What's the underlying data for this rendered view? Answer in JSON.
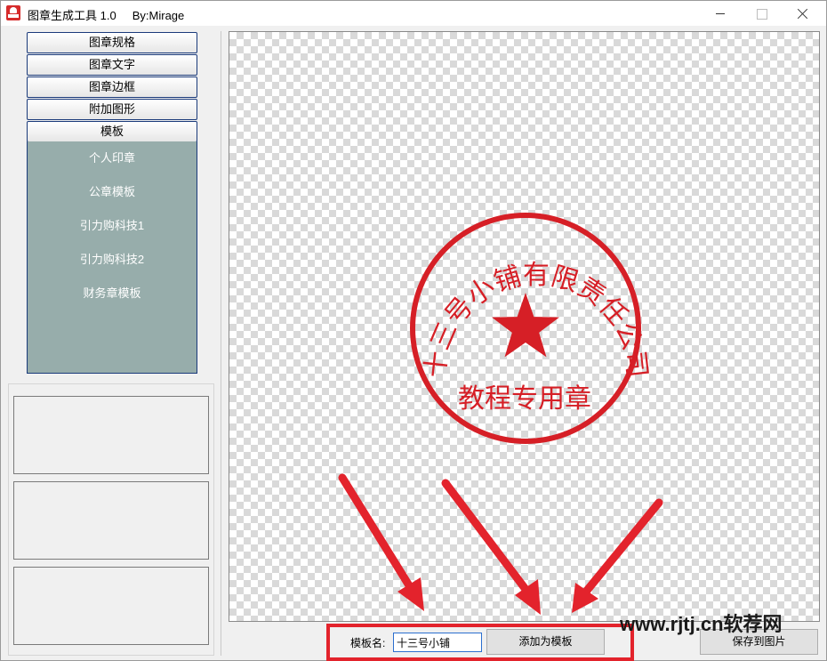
{
  "window": {
    "title": "图章生成工具 1.0     By:Mirage"
  },
  "menu": {
    "items": [
      {
        "label": "图章规格"
      },
      {
        "label": "图章文字"
      },
      {
        "label": "图章边框"
      },
      {
        "label": "附加图形"
      },
      {
        "label": "模板"
      }
    ]
  },
  "templates": {
    "items": [
      {
        "label": "个人印章"
      },
      {
        "label": "公章模板"
      },
      {
        "label": "引力购科技1"
      },
      {
        "label": "引力购科技2"
      },
      {
        "label": "财务章模板"
      }
    ]
  },
  "seal": {
    "color": "#d61f26",
    "arc_text": "十三号小铺有限责任公司",
    "bottom_text": "教程专用章"
  },
  "bottom": {
    "template_name_label": "模板名:",
    "template_name_value": "十三号小铺",
    "add_template_label": "添加为模板",
    "save_image_label": "保存到图片"
  },
  "watermark": "www.rjtj.cn软荐网",
  "colors": {
    "template_panel": "#97adab",
    "highlight": "#e3232c"
  }
}
